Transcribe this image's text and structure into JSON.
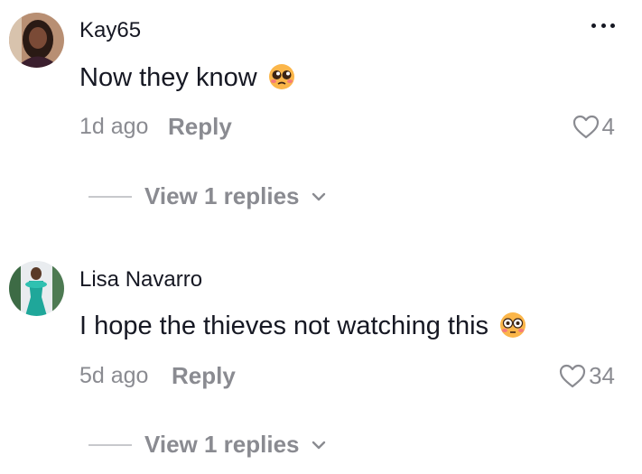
{
  "comments": [
    {
      "username": "Kay65",
      "text": "Now they know",
      "emoji_icon": "pleading-face-emoji",
      "time": "1d ago",
      "reply_label": "Reply",
      "likes": "4",
      "view_replies": "View 1 replies"
    },
    {
      "username": "Lisa Navarro",
      "text": "I hope the thieves not watching this",
      "emoji_icon": "flushed-face-emoji",
      "time": "5d ago",
      "reply_label": "Reply",
      "likes": "34",
      "view_replies": "View 1 replies"
    }
  ],
  "colors": {
    "text": "#161823",
    "muted": "#8a8b91"
  },
  "icons": [
    "more-options-icon",
    "heart-icon",
    "chevron-down-icon"
  ]
}
